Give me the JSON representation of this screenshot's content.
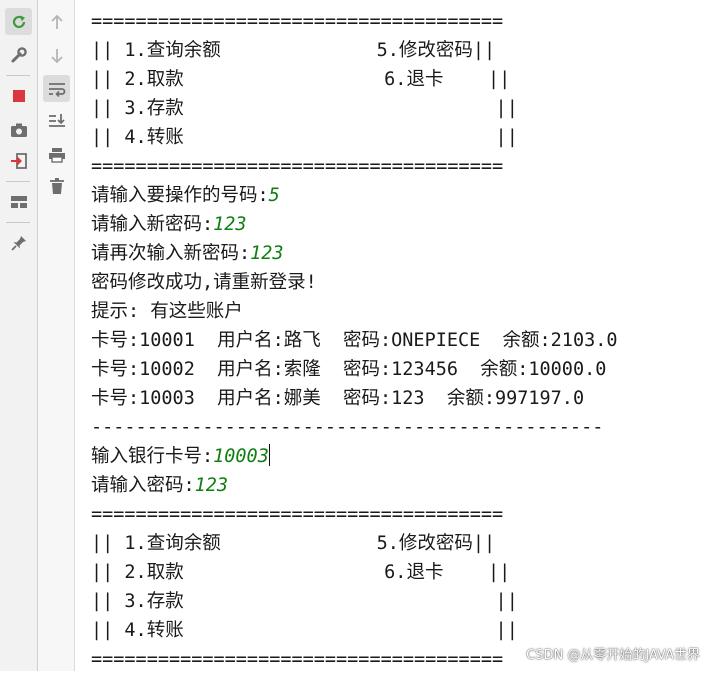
{
  "console": {
    "lines": [
      {
        "text": "=====================================",
        "input": ""
      },
      {
        "text": "|| 1.查询余额              5.修改密码||",
        "input": ""
      },
      {
        "text": "|| 2.取款                  6.退卡    ||",
        "input": ""
      },
      {
        "text": "|| 3.存款                            ||",
        "input": ""
      },
      {
        "text": "|| 4.转账                            ||",
        "input": ""
      },
      {
        "text": "=====================================",
        "input": ""
      },
      {
        "text": "请输入要操作的号码:",
        "input": "5"
      },
      {
        "text": "请输入新密码:",
        "input": "123"
      },
      {
        "text": "请再次输入新密码:",
        "input": "123"
      },
      {
        "text": "密码修改成功,请重新登录!",
        "input": ""
      },
      {
        "text": "提示: 有这些账户",
        "input": ""
      },
      {
        "text": "卡号:10001  用户名:路飞  密码:ONEPIECE  余额:2103.0",
        "input": ""
      },
      {
        "text": "卡号:10002  用户名:索隆  密码:123456  余额:10000.0",
        "input": ""
      },
      {
        "text": "卡号:10003  用户名:娜美  密码:123  余额:997197.0",
        "input": ""
      },
      {
        "text": "----------------------------------------------",
        "input": ""
      },
      {
        "text": "输入银行卡号:",
        "input": "10003"
      },
      {
        "text": "请输入密码:",
        "input": "123"
      },
      {
        "text": "=====================================",
        "input": ""
      },
      {
        "text": "|| 1.查询余额              5.修改密码||",
        "input": ""
      },
      {
        "text": "|| 2.取款                  6.退卡    ||",
        "input": ""
      },
      {
        "text": "|| 3.存款                            ||",
        "input": ""
      },
      {
        "text": "|| 4.转账                            ||",
        "input": ""
      },
      {
        "text": "=====================================",
        "input": ""
      }
    ],
    "caret_line": 15
  },
  "watermark": "CSDN @从零开始的JAVA世界",
  "icons": {
    "toolbar1": [
      "rerun-icon",
      "wrench-icon",
      "stop-icon",
      "camera-icon",
      "login-icon",
      "layout-icon",
      "pin-icon"
    ],
    "toolbar2": [
      "arrow-up-icon",
      "arrow-down-icon",
      "soft-wrap-icon",
      "scroll-to-end-icon",
      "print-icon",
      "trash-icon"
    ]
  },
  "colors": {
    "input": "#0f7f12",
    "stop": "#d9363e",
    "rerun": "#3f9a3f",
    "icon": "#6e6e6e"
  }
}
